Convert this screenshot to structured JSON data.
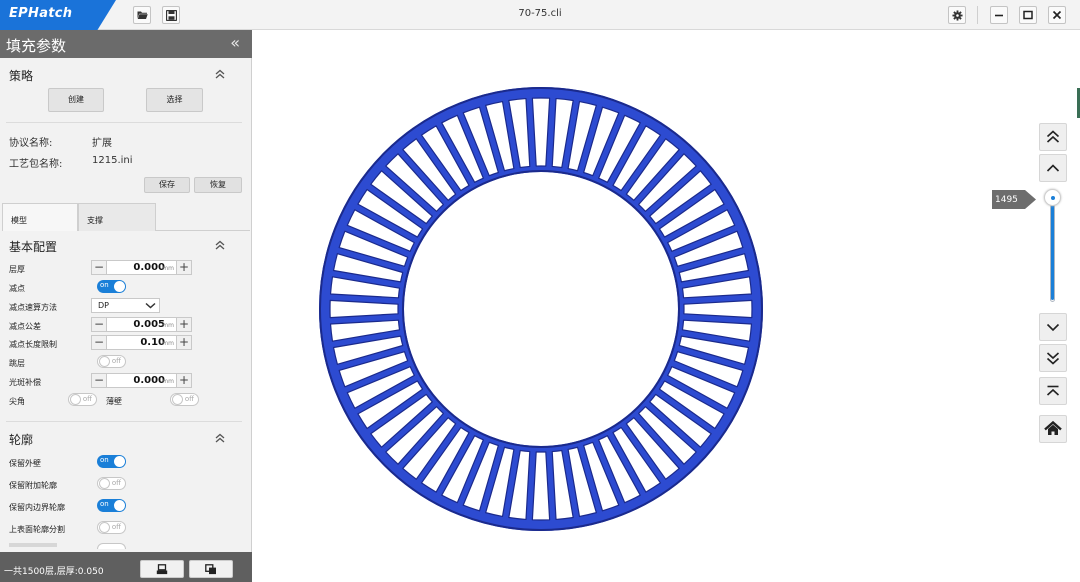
{
  "app": {
    "name": "EPHatch",
    "file_title": "70-75.cli"
  },
  "titlebar": {
    "icons": [
      "folder-open-icon",
      "save-icon"
    ],
    "window_icons": [
      "gear-icon",
      "minimize-icon",
      "maximize-icon",
      "close-icon"
    ]
  },
  "panel": {
    "title": "填充参数",
    "strategy": {
      "title": "策略",
      "create_label": "创建",
      "select_label": "选择"
    },
    "protocol_label": "协议名称:",
    "protocol_value": "扩展",
    "package_label": "工艺包名称:",
    "package_value": "1215.ini",
    "save_label": "保存",
    "restore_label": "恢复",
    "tabs": [
      "模型",
      "支撑"
    ],
    "basic": {
      "title": "基本配置",
      "layer_thickness": {
        "label": "层厚",
        "value": "0.000",
        "unit": "mm"
      },
      "reduce_points": {
        "label": "减点",
        "state": "on"
      },
      "reduce_algorithm": {
        "label": "减点速算方法",
        "value": "DP"
      },
      "reduce_tolerance": {
        "label": "减点公差",
        "value": "0.005",
        "unit": "mm"
      },
      "reduce_length_limit": {
        "label": "减点长度限制",
        "value": "0.10",
        "unit": "mm"
      },
      "skip_layer": {
        "label": "跳层",
        "state": "off"
      },
      "spot_compensation": {
        "label": "光斑补偿",
        "value": "0.000",
        "unit": "mm"
      },
      "sharp_corner": {
        "label": "尖角",
        "state": "off"
      },
      "thin_wall": {
        "label": "薄壁",
        "state": "off"
      }
    },
    "contour": {
      "title": "轮廓",
      "keep_outer_wall": {
        "label": "保留外壁",
        "state": "on"
      },
      "keep_extra_contour": {
        "label": "保留附加轮廓",
        "state": "off"
      },
      "keep_inner_boundary": {
        "label": "保留内边界轮廓",
        "state": "on"
      },
      "upper_surface_split": {
        "label": "上表面轮廓分割",
        "state": "off"
      }
    },
    "status": "一共1500层,层厚:0.050"
  },
  "viewer": {
    "ring_segments": 56,
    "colors": {
      "outline": "#2d4bd1",
      "outline_dark": "#1b2a8c",
      "accent": "#1a7fd8"
    }
  },
  "layer_nav": {
    "current_layer": "1495",
    "total_layers": 1500
  }
}
